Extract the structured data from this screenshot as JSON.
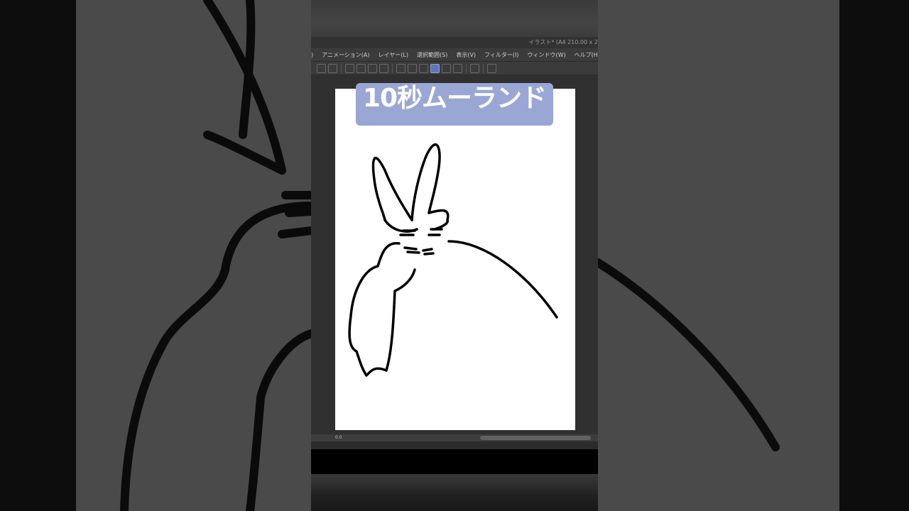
{
  "window": {
    "title": "イラスト* (A4 210.00 x 2"
  },
  "menu": {
    "items": [
      ")",
      "アニメーション(A)",
      "レイヤー(L)",
      "選択範囲(S)",
      "表示(V)",
      "フィルター(I)",
      "ウィンドウ(W)",
      "ヘルプ(H)"
    ]
  },
  "toolbar": {
    "icons": [
      "undo-icon",
      "redo-icon",
      "lasso-icon",
      "transform-icon",
      "fill-icon",
      "crop-icon",
      "select-icon",
      "gradient-icon",
      "frame-icon",
      "pen-icon",
      "brush-icon",
      "eraser-icon",
      "save-icon",
      "help-icon"
    ]
  },
  "overlay": {
    "caption": "10秒ムーランド",
    "color": "#9aa7d4"
  },
  "statusbar": {
    "zoom": "0.0"
  }
}
